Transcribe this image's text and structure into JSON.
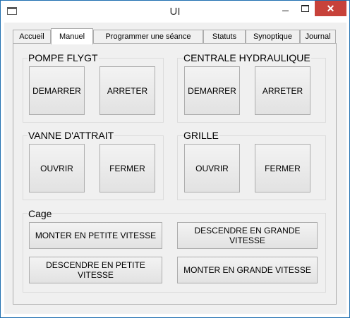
{
  "window": {
    "title": "UI",
    "close_glyph": "✕"
  },
  "tabs": [
    {
      "label": "Accueil"
    },
    {
      "label": "Manuel"
    },
    {
      "label": "Programmer une séance"
    },
    {
      "label": "Statuts"
    },
    {
      "label": "Synoptique"
    },
    {
      "label": "Journal"
    }
  ],
  "groups": {
    "pompe": {
      "title": "POMPE FLYGT",
      "start": "DEMARRER",
      "stop": "ARRETER"
    },
    "centrale": {
      "title": "CENTRALE HYDRAULIQUE",
      "start": "DEMARRER",
      "stop": "ARRETER"
    },
    "vanne": {
      "title": "VANNE D'ATTRAIT",
      "open": "OUVRIR",
      "close": "FERMER"
    },
    "grille": {
      "title": "GRILLE",
      "open": "OUVRIR",
      "close": "FERMER"
    },
    "cage": {
      "title": "Cage",
      "up_slow": "MONTER EN PETITE VITESSE",
      "down_fast": "DESCENDRE EN GRANDE VITESSE",
      "down_slow": "DESCENDRE EN PETITE VITESSE",
      "up_fast": "MONTER EN GRANDE VITESSE"
    }
  }
}
